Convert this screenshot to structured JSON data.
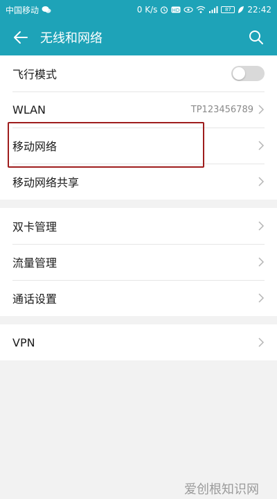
{
  "status_bar": {
    "carrier": "中国移动",
    "speed": "0 K/s",
    "battery": "87",
    "time": "22:42",
    "icons": [
      "wechat-icon",
      "alarm-icon",
      "hd-icon",
      "eye-icon",
      "wifi-icon",
      "signal-icon",
      "battery-icon",
      "leaf-icon"
    ]
  },
  "app_bar": {
    "title": "无线和网络",
    "back_icon": "arrow-left-icon",
    "search_icon": "search-icon"
  },
  "groups": [
    [
      {
        "label": "飞行模式",
        "type": "toggle",
        "on": false
      },
      {
        "label": "WLAN",
        "value": "TP123456789",
        "type": "chevron"
      },
      {
        "label": "移动网络",
        "type": "chevron"
      },
      {
        "label": "移动网络共享",
        "type": "chevron"
      }
    ],
    [
      {
        "label": "双卡管理",
        "type": "chevron"
      },
      {
        "label": "流量管理",
        "type": "chevron"
      },
      {
        "label": "通话设置",
        "type": "chevron"
      }
    ],
    [
      {
        "label": "VPN",
        "type": "chevron"
      }
    ]
  ],
  "colors": {
    "accent": "#1ea3b8",
    "highlight_border": "#9e1c1c"
  },
  "watermark": "爱创根知识网"
}
